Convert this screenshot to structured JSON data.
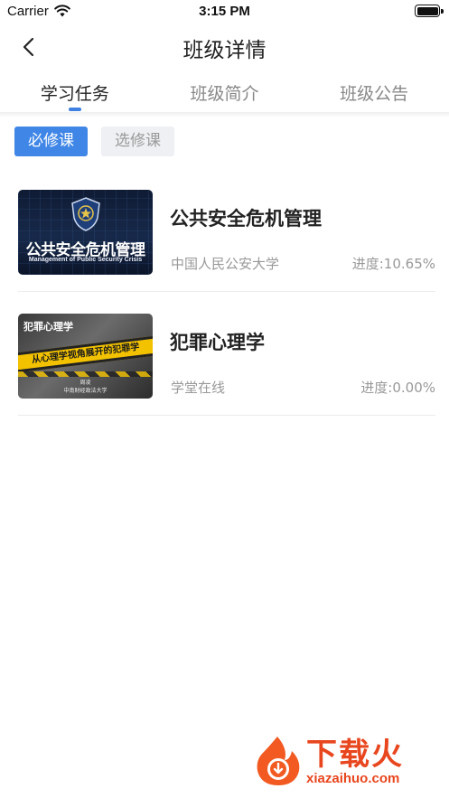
{
  "status_bar": {
    "carrier": "Carrier",
    "time": "3:15 PM"
  },
  "nav": {
    "title": "班级详情"
  },
  "tabs": [
    {
      "label": "学习任务",
      "active": true
    },
    {
      "label": "班级简介",
      "active": false
    },
    {
      "label": "班级公告",
      "active": false
    }
  ],
  "filters": {
    "required": "必修课",
    "elective": "选修课"
  },
  "courses": [
    {
      "title": "公共安全危机管理",
      "source": "中国人民公安大学",
      "progress": "进度:10.65%",
      "thumbnail": {
        "title": "公共安全危机管理",
        "subtitle": "Management of Public Security Crisis"
      }
    },
    {
      "title": "犯罪心理学",
      "source": "学堂在线",
      "progress": "进度:0.00%",
      "thumbnail": {
        "heading": "犯罪心理学",
        "tape": "从心理学视角展开的犯罪学",
        "author": "周凌",
        "school": "中南财经政法大学"
      }
    }
  ],
  "watermark": {
    "brand": "下载火",
    "domain": "xiazaihuo.com"
  },
  "colors": {
    "accent": "#3f86e6",
    "watermark": "#e8461e"
  }
}
